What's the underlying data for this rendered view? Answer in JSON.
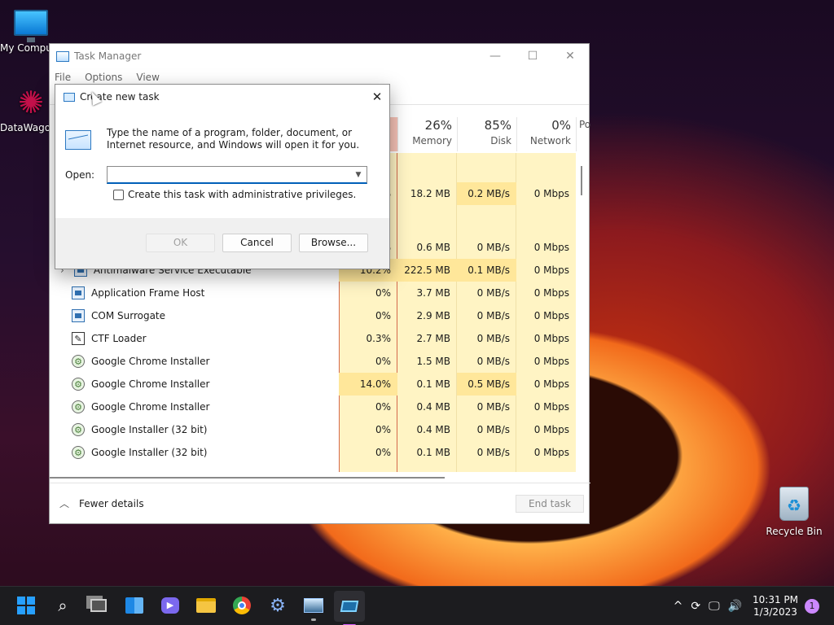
{
  "desktop": {
    "icons": [
      {
        "label": "My Computer",
        "icon": "monitor-icon"
      },
      {
        "label": "DataWagon",
        "icon": "datawagon-logo-icon"
      },
      {
        "label": "Recycle Bin",
        "icon": "recycle-bin-icon"
      }
    ]
  },
  "task_manager": {
    "title": "Task Manager",
    "window_buttons": {
      "minimize": "—",
      "maximize": "☐",
      "close": "✕"
    },
    "menu": [
      "File",
      "Options",
      "View"
    ],
    "columns": [
      {
        "pct": "26%",
        "label": "Memory"
      },
      {
        "pct": "85%",
        "label": "Disk"
      },
      {
        "pct": "0%",
        "label": "Network"
      },
      {
        "pct": "",
        "label": "Po"
      }
    ],
    "rows_partial": [
      {
        "cpu": "%",
        "memory": "18.2 MB",
        "disk": "0.2 MB/s",
        "network": "0 Mbps"
      },
      {
        "cpu": "%",
        "memory": "0.6 MB",
        "disk": "0 MB/s",
        "network": "0 Mbps"
      }
    ],
    "rows": [
      {
        "name": "Antimalware Service Executable",
        "icon": "shield-icon",
        "cpu": "10.2%",
        "memory": "222.5 MB",
        "disk": "0.1 MB/s",
        "network": "0 Mbps"
      },
      {
        "name": "Application Frame Host",
        "icon": "window-icon",
        "cpu": "0%",
        "memory": "3.7 MB",
        "disk": "0 MB/s",
        "network": "0 Mbps"
      },
      {
        "name": "COM Surrogate",
        "icon": "window-icon",
        "cpu": "0%",
        "memory": "2.9 MB",
        "disk": "0 MB/s",
        "network": "0 Mbps"
      },
      {
        "name": "CTF Loader",
        "icon": "ctf-icon",
        "cpu": "0.3%",
        "memory": "2.7 MB",
        "disk": "0 MB/s",
        "network": "0 Mbps"
      },
      {
        "name": "Google Chrome Installer",
        "icon": "installer-icon",
        "cpu": "0%",
        "memory": "1.5 MB",
        "disk": "0 MB/s",
        "network": "0 Mbps"
      },
      {
        "name": "Google Chrome Installer",
        "icon": "installer-icon",
        "cpu": "14.0%",
        "memory": "0.1 MB",
        "disk": "0.5 MB/s",
        "network": "0 Mbps"
      },
      {
        "name": "Google Chrome Installer",
        "icon": "installer-icon",
        "cpu": "0%",
        "memory": "0.4 MB",
        "disk": "0 MB/s",
        "network": "0 Mbps"
      },
      {
        "name": "Google Installer (32 bit)",
        "icon": "installer-icon",
        "cpu": "0%",
        "memory": "0.4 MB",
        "disk": "0 MB/s",
        "network": "0 Mbps"
      },
      {
        "name": "Google Installer (32 bit)",
        "icon": "installer-icon",
        "cpu": "0%",
        "memory": "0.1 MB",
        "disk": "0 MB/s",
        "network": "0 Mbps"
      }
    ],
    "footer": {
      "fewer_details": "Fewer details",
      "end_task": "End task"
    }
  },
  "run_dialog": {
    "title": "Create new task",
    "description": "Type the name of a program, folder, document, or Internet resource, and Windows will open it for you.",
    "open_label": "Open:",
    "open_value": "",
    "admin_checkbox_label": "Create this task with administrative privileges.",
    "admin_checked": false,
    "buttons": {
      "ok": "OK",
      "cancel": "Cancel",
      "browse": "Browse..."
    }
  },
  "taskbar": {
    "pinned": [
      "start-icon",
      "search-icon",
      "task-view-icon",
      "widgets-icon",
      "chat-icon",
      "file-explorer-icon",
      "chrome-icon",
      "settings-icon",
      "task-manager-icon",
      "run-icon"
    ],
    "time": "10:31 PM",
    "date": "1/3/2023",
    "notification_count": "1"
  },
  "colors": {
    "accent": "#005fb8",
    "heat_light": "#fff4c4",
    "heat_medium": "#ffe79a"
  }
}
